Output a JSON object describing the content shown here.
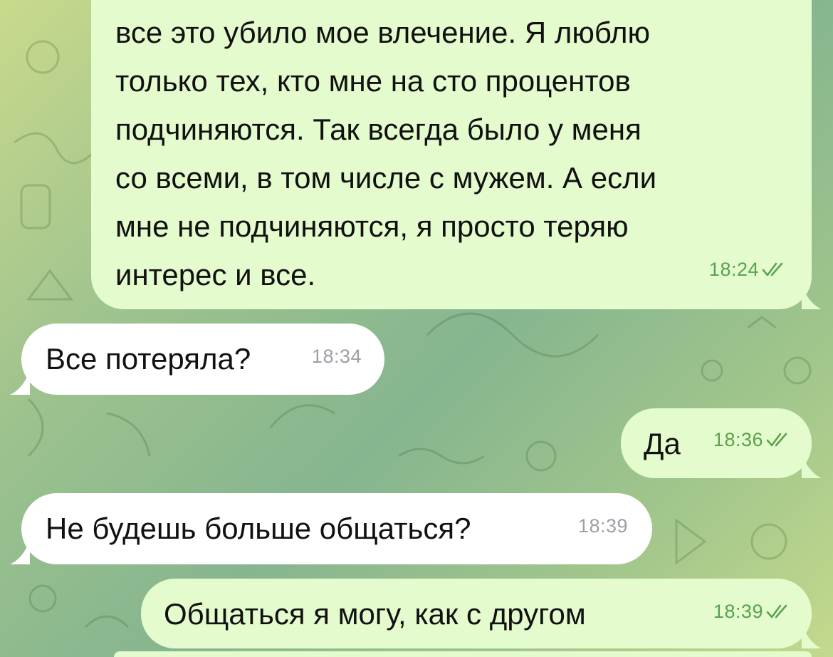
{
  "chat": {
    "messages": [
      {
        "direction": "outgoing",
        "lines": [
          "все это убило мое влечение. Я люблю",
          "только тех, кто мне на сто процентов",
          "подчиняются. Так всегда было у меня",
          "со всеми, в том числе с мужем. А если",
          "мне не подчиняются, я просто теряю",
          "интерес и все."
        ],
        "time": "18:24",
        "status_icon": "double-check-icon"
      },
      {
        "direction": "incoming",
        "text": "Все потеряла?",
        "time": "18:34"
      },
      {
        "direction": "outgoing",
        "text": "Да",
        "time": "18:36",
        "status_icon": "double-check-icon"
      },
      {
        "direction": "incoming",
        "text": "Не будешь больше общаться?",
        "time": "18:39"
      },
      {
        "direction": "outgoing",
        "text": "Общаться я могу, как с другом",
        "time": "18:39",
        "status_icon": "double-check-icon"
      }
    ]
  },
  "colors": {
    "outgoing_bubble": "#e4fbcd",
    "incoming_bubble": "#ffffff",
    "outgoing_time": "#5aa04e",
    "incoming_time": "#9aa0a6",
    "wallpaper_accent": "#9cc28e"
  }
}
